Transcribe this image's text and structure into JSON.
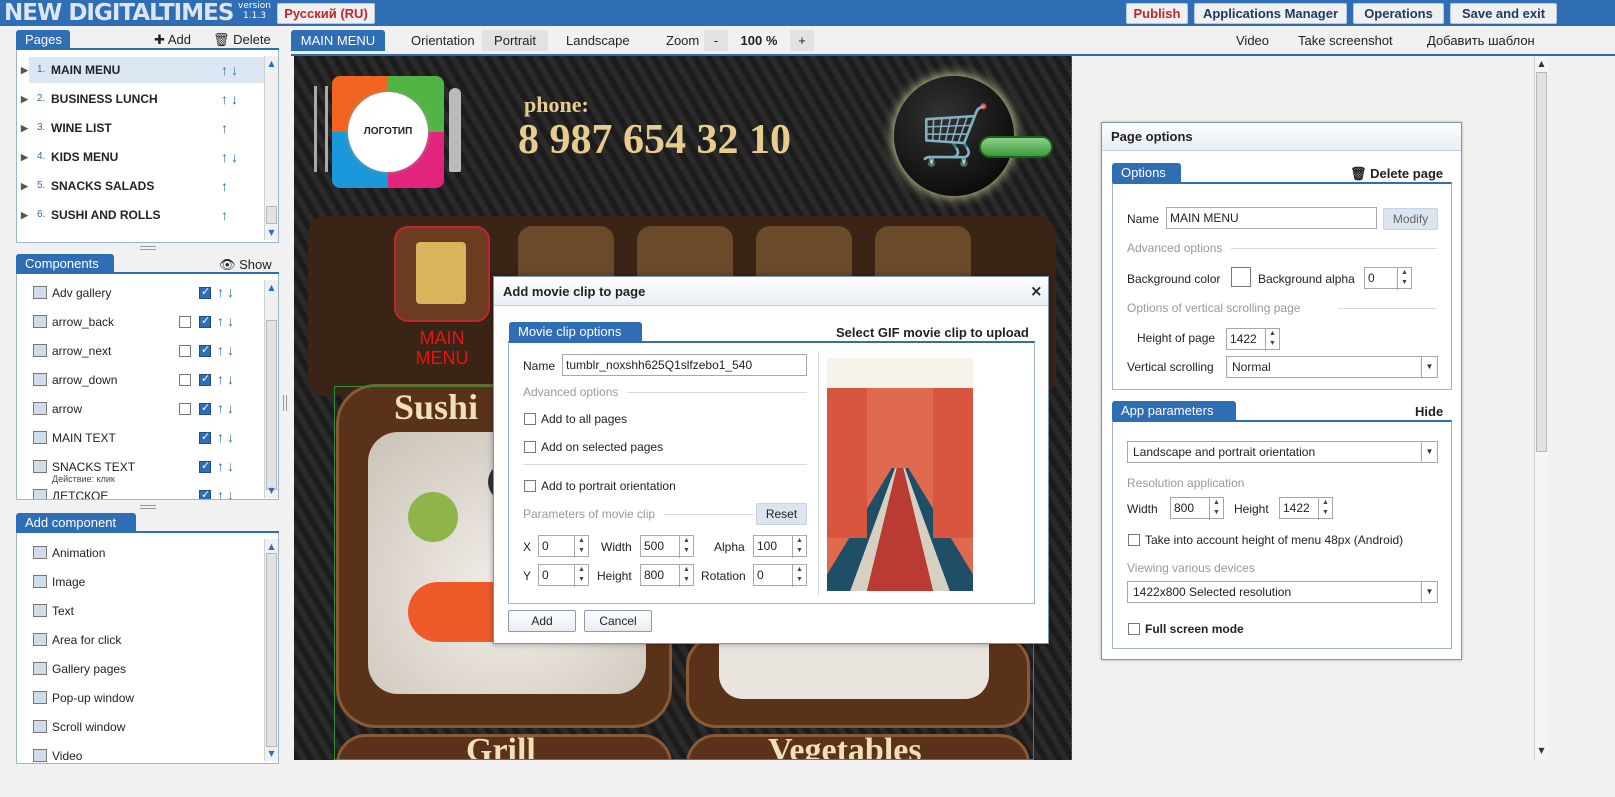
{
  "app": {
    "logo": "NEW DIGITALTIMES",
    "version_label": "version",
    "version_number": "1.1.3",
    "language": "Русский (RU)",
    "publish": "Publish",
    "apps_manager": "Applications Manager",
    "operations": "Operations",
    "save_exit": "Save and exit",
    "accent_color": "#2f6db4"
  },
  "toolbar": {
    "current_page": "MAIN MENU",
    "orientation_label": "Orientation",
    "portrait": "Portrait",
    "landscape": "Landscape",
    "zoom_label": "Zoom",
    "zoom_minus": "-",
    "zoom_value": "100",
    "zoom_unit": "%",
    "zoom_plus": "+",
    "video": "Video",
    "screenshot": "Take screenshot",
    "add_template": "Добавить шаблон"
  },
  "pages_panel": {
    "title": "Pages",
    "add": "Add",
    "delete": "Delete",
    "items": [
      {
        "num": "1.",
        "name": "MAIN MENU",
        "arrows": "↑↓"
      },
      {
        "num": "2.",
        "name": "BUSINESS LUNCH",
        "arrows": "↑↓"
      },
      {
        "num": "3.",
        "name": "WINE LIST",
        "arrows": "↑"
      },
      {
        "num": "4.",
        "name": "KIDS MENU",
        "arrows": "↑↓"
      },
      {
        "num": "5.",
        "name": "SNACKS SALADS",
        "arrows": "↑"
      },
      {
        "num": "6.",
        "name": "SUSHI AND ROLLS",
        "arrows": "↑"
      }
    ]
  },
  "components_panel": {
    "title": "Components",
    "show": "Show",
    "items": [
      {
        "name": "Adv gallery",
        "sub": ""
      },
      {
        "name": "arrow_back",
        "sub": ""
      },
      {
        "name": "arrow_next",
        "sub": ""
      },
      {
        "name": "arrow_down",
        "sub": ""
      },
      {
        "name": "arrow",
        "sub": ""
      },
      {
        "name": "MAIN TEXT",
        "sub": ""
      },
      {
        "name": "SNACKS TEXT",
        "sub": "Действие: клик"
      },
      {
        "name": "ДЕТСКОЕ",
        "sub": ""
      }
    ]
  },
  "add_component_panel": {
    "title": "Add component",
    "items": [
      "Animation",
      "Image",
      "Text",
      "Area for click",
      "Gallery pages",
      "Pop-up window",
      "Scroll window",
      "Video"
    ]
  },
  "canvas": {
    "phone_label": "phone:",
    "phone_number": "8 987 654 32 10",
    "logo_text": "ЛОГОТИП",
    "menu_tile_label_1": "MAIN",
    "menu_tile_label_2": "MENU",
    "card_sushi": "Sushi",
    "card_grill": "Grill",
    "card_vegetables": "Vegetables"
  },
  "movie_dialog": {
    "title": "Add movie clip to page",
    "close": "×",
    "tab": "Movie clip options",
    "upload": "Select GIF movie clip to upload",
    "name_label": "Name",
    "name_value": "tumblr_noxshh625Q1slfzebo1_540",
    "advanced": "Advanced options",
    "add_all": "Add to all pages",
    "add_selected": "Add on selected pages",
    "add_portrait": "Add to portrait orientation",
    "params": "Parameters of movie clip",
    "reset": "Reset",
    "x_label": "X",
    "x_value": "0",
    "width_label": "Width",
    "width_value": "500",
    "alpha_label": "Alpha",
    "alpha_value": "100",
    "y_label": "Y",
    "y_value": "0",
    "height_label": "Height",
    "height_value": "800",
    "rotation_label": "Rotation",
    "rotation_value": "0",
    "add_btn": "Add",
    "cancel_btn": "Cancel"
  },
  "page_options": {
    "title": "Page options",
    "tab": "Options",
    "delete_page": "Delete page",
    "name_label": "Name",
    "name_value": "MAIN MENU",
    "modify": "Modify",
    "advanced": "Advanced options",
    "bg_color_label": "Background color",
    "bg_alpha_label": "Background alpha",
    "bg_alpha_value": "0",
    "vertical_options": "Options of vertical scrolling page",
    "height_label": "Height of page",
    "height_value": "1422",
    "vertical_scrolling_label": "Vertical scrolling",
    "vertical_scrolling_value": "Normal",
    "app_params_tab": "App parameters",
    "hide": "Hide",
    "orientation_value": "Landscape and portrait orientation",
    "resolution_label": "Resolution application",
    "width_label": "Width",
    "width_value": "800",
    "height2_label": "Height",
    "height2_value": "1422",
    "menu_height_label": "Take into account height of menu 48px (Android)",
    "devices_label": "Viewing various devices",
    "devices_value": "1422x800 Selected resolution",
    "fullscreen_label": "Full screen mode"
  }
}
